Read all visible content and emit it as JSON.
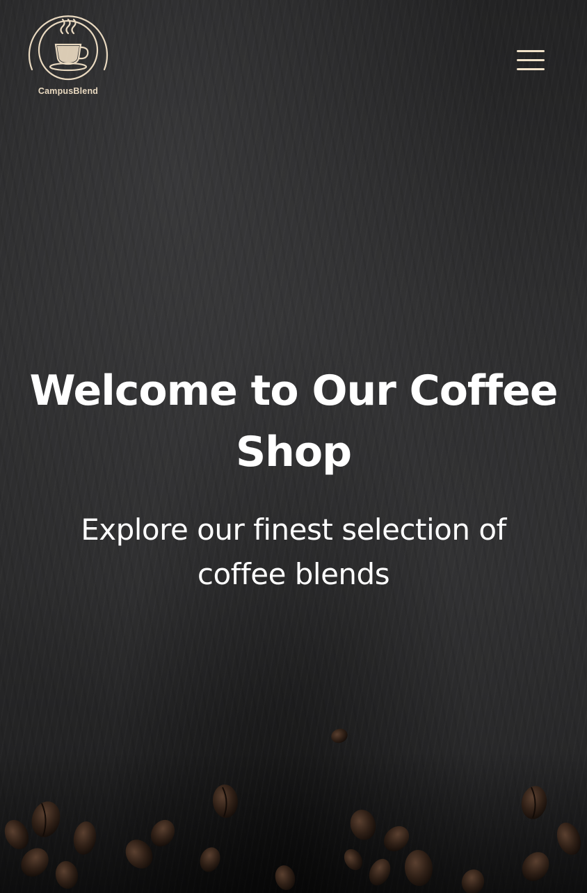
{
  "header": {
    "logo_label": "CampusBlend",
    "logo_icon": "coffee-cup-icon",
    "menu_icon": "hamburger-menu-icon"
  },
  "hero": {
    "title": "Welcome to Our Coffee Shop",
    "subtitle": "Explore our finest selection of coffee blends"
  },
  "colors": {
    "brand_cream": "#e9d9c0",
    "menu_icon": "#f1e2c9",
    "text": "#ffffff",
    "background": "#2a2a2b"
  }
}
